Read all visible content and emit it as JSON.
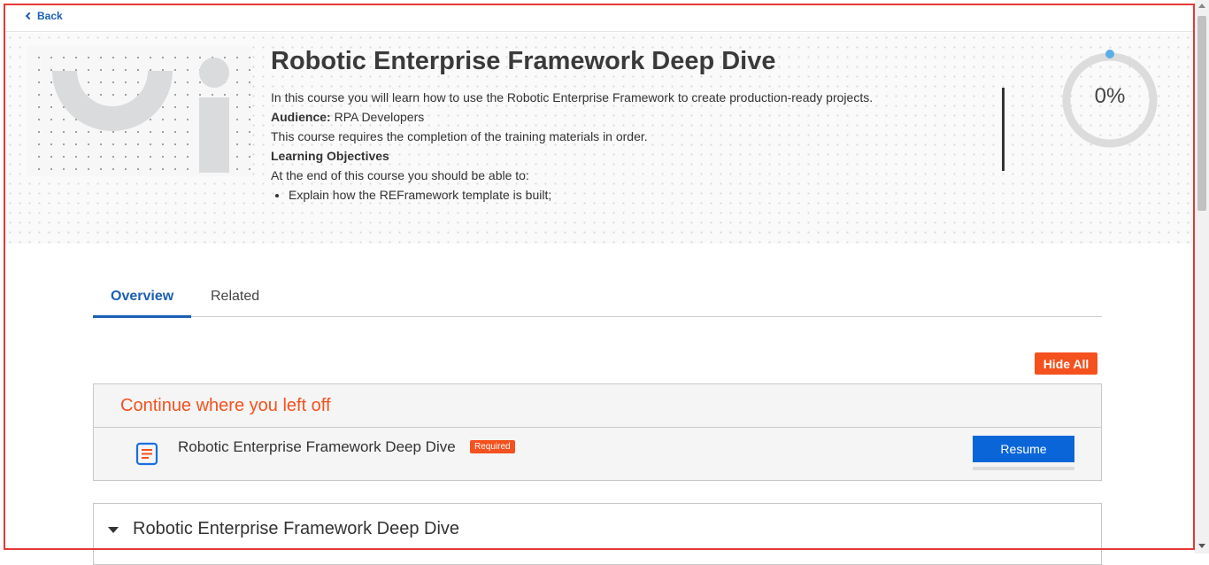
{
  "nav": {
    "back_label": "Back"
  },
  "course": {
    "title": "Robotic Enterprise Framework Deep Dive",
    "intro": "In this course you will learn how to use the Robotic Enterprise Framework to create production-ready projects.",
    "audience_label": "Audience:",
    "audience_value": " RPA Developers",
    "requirement_note": "This course requires the completion of the training materials in order.",
    "objectives_heading": "Learning Objectives",
    "objectives_intro": "At the end of this course you should be able to:",
    "objectives": [
      "Explain how the REFramework template is built;"
    ],
    "progress_percent": 0,
    "progress_label": "0%"
  },
  "tabs": [
    {
      "label": "Overview",
      "active": true
    },
    {
      "label": "Related",
      "active": false
    }
  ],
  "actions": {
    "hide_all_label": "Hide All"
  },
  "continue_section": {
    "heading": "Continue where you left off",
    "lesson_title": "Robotic Enterprise Framework Deep Dive",
    "badge": "Required",
    "resume_label": "Resume",
    "icon": "document-icon"
  },
  "module": {
    "title": "Robotic Enterprise Framework Deep Dive",
    "icon": "caret-down-icon"
  },
  "colors": {
    "accent_blue": "#1a5fb4",
    "accent_orange": "#f4511e",
    "button_blue": "#0a66d8"
  }
}
